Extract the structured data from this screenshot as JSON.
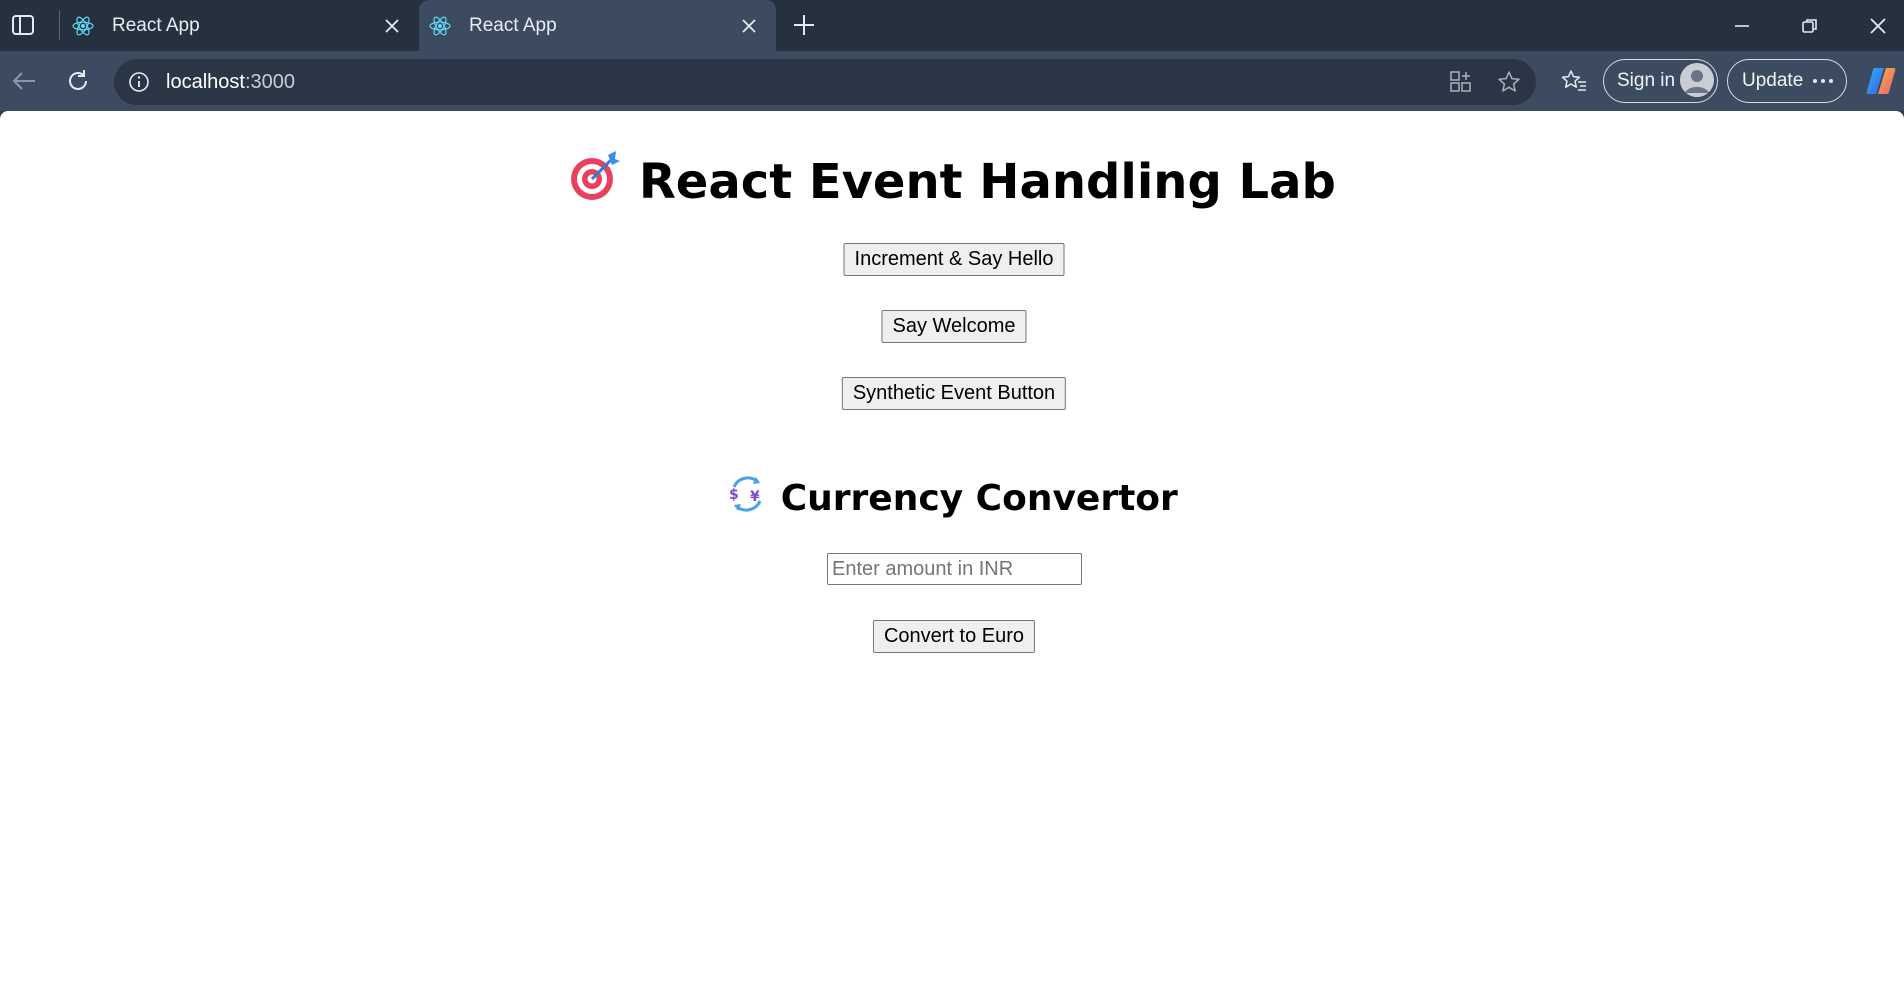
{
  "browser": {
    "tabs": [
      {
        "label": "React App",
        "active": false
      },
      {
        "label": "React App",
        "active": true
      }
    ],
    "address": {
      "host": "localhost",
      "port": ":3000"
    },
    "sign_in_label": "Sign in",
    "update_label": "Update",
    "icons": [
      "sidebar-icon",
      "react-icon",
      "close-icon",
      "plus-icon",
      "minimize-icon",
      "restore-icon",
      "back-icon",
      "reload-icon",
      "info-icon",
      "apps-icon",
      "star-icon",
      "favorites-icon",
      "avatar",
      "more-icon",
      "copilot-icon"
    ],
    "colors": {
      "chrome_dark": "#263140",
      "chrome": "#3c4b5f",
      "accent_react": "#61dafb"
    }
  },
  "page": {
    "title": "React Event Handling Lab",
    "title_emoji": "🎯",
    "buttons": {
      "increment": "Increment & Say Hello",
      "welcome": "Say Welcome",
      "synthetic": "Synthetic Event Button"
    },
    "converter": {
      "heading": "Currency Convertor",
      "heading_emoji": "💱",
      "amount_placeholder": "Enter amount in INR",
      "amount_value": "",
      "convert_label": "Convert to Euro"
    }
  }
}
